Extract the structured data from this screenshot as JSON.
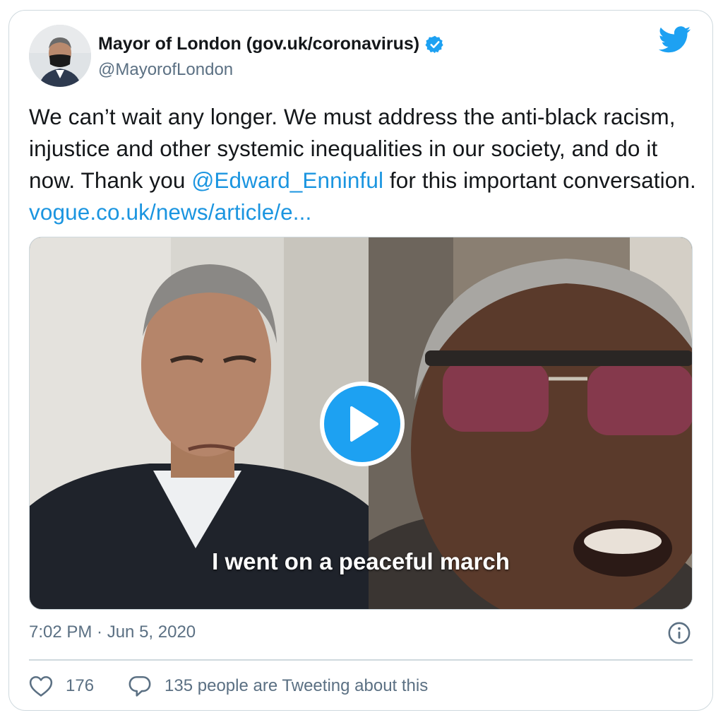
{
  "author": {
    "display_name": "Mayor of London (gov.uk/coronavirus)",
    "handle": "@MayorofLondon",
    "verified": true
  },
  "tweet": {
    "text_part1": "We can’t wait any longer. We must address the anti-black racism, injustice and other systemic inequalities in our society, and do it now. Thank you ",
    "mention": "@Edward_Enninful",
    "text_part2": " for this important conversation. ",
    "link": "vogue.co.uk/news/article/e..."
  },
  "media": {
    "type": "video",
    "caption": "I went on a peaceful march"
  },
  "meta": {
    "timestamp": "7:02 PM · Jun 5, 2020"
  },
  "engagement": {
    "likes": "176",
    "tweeting_text": "135 people are Tweeting about this"
  },
  "colors": {
    "link": "#1b95e0",
    "brand": "#1da1f2",
    "secondary_text": "#5b7083",
    "border": "#cfd9de"
  },
  "icons": {
    "logo": "twitter-bird-icon",
    "verified": "verified-badge-icon",
    "play": "play-icon",
    "info": "info-icon",
    "like": "heart-icon",
    "reply": "speech-bubble-icon"
  }
}
